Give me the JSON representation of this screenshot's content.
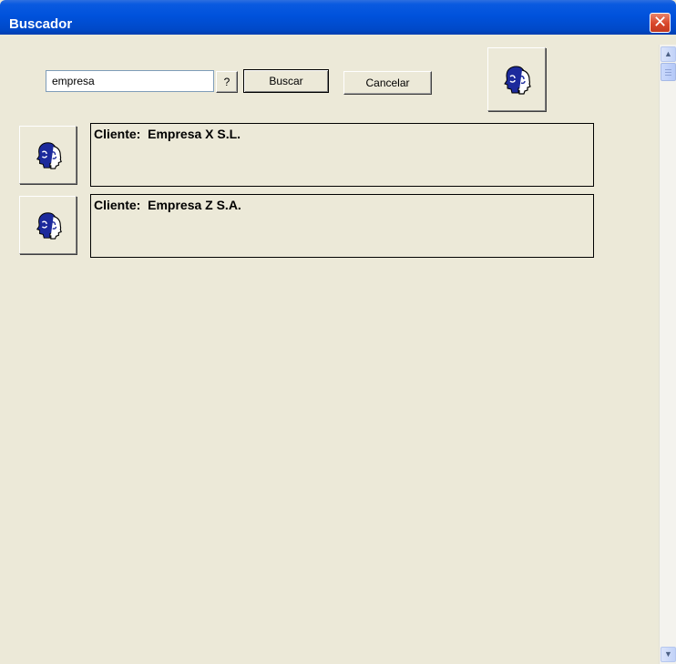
{
  "window": {
    "title": "Buscador",
    "close_glyph": "✕"
  },
  "search": {
    "value": "empresa",
    "help_label": "?",
    "search_label": "Buscar",
    "cancel_label": "Cancelar"
  },
  "results": [
    {
      "label": "Cliente:  Empresa X S.L.",
      "icon": "clients-icon"
    },
    {
      "label": "Cliente:  Empresa Z S.A.",
      "icon": "clients-icon"
    }
  ],
  "icons": {
    "top_button": "clients-icon",
    "scroll_up": "▲",
    "scroll_down": "▼"
  },
  "colors": {
    "titlebar": "#0052dc",
    "background": "#ece9d8",
    "icon_blue": "#1c2a9c"
  }
}
